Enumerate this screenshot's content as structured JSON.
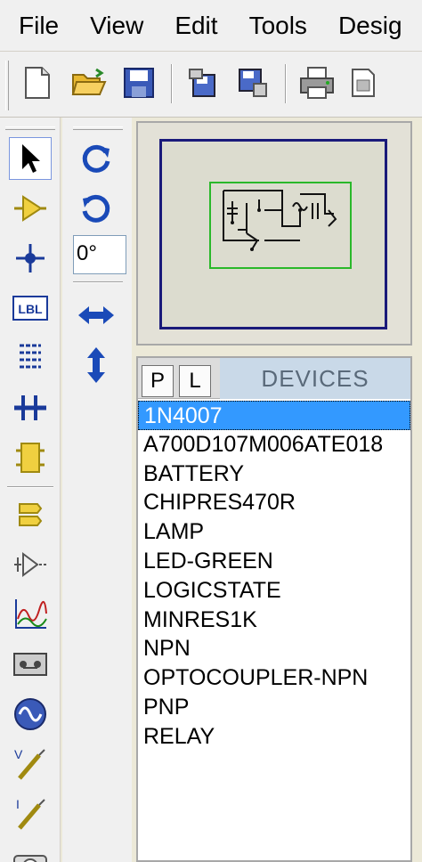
{
  "menu": [
    "File",
    "View",
    "Edit",
    "Tools",
    "Desig"
  ],
  "toolbar": {
    "buttons": [
      "new-file-icon",
      "open-folder-icon",
      "save-icon",
      "import-section-icon",
      "export-section-icon",
      "print-icon",
      "set-area-icon"
    ]
  },
  "left_tools": [
    "selection-arrow-icon",
    "component-icon",
    "junction-dot-icon",
    "wire-label-icon",
    "text-script-icon",
    "buses-icon",
    "subcircuit-icon",
    "terminals-icon",
    "device-pins-icon",
    "graph-icon",
    "tape-recorder-icon",
    "generator-icon",
    "voltage-probe-icon",
    "current-probe-icon",
    "virtual-instruments-icon"
  ],
  "rotation": {
    "angle_value": "0°"
  },
  "devices": {
    "pick_label": "P",
    "library_label": "L",
    "title": "DEVICES",
    "selected": "1N4007",
    "items": [
      "1N4007",
      "A700D107M006ATE018",
      "BATTERY",
      "CHIPRES470R",
      "LAMP",
      "LED-GREEN",
      "LOGICSTATE",
      "MINRES1K",
      "NPN",
      "OPTOCOUPLER-NPN",
      "PNP",
      "RELAY"
    ]
  },
  "colors": {
    "sheet_border": "#1a1a7a",
    "view_box": "#2ab82a",
    "selection": "#3399ff",
    "header_blue": "#c9d9e8"
  }
}
